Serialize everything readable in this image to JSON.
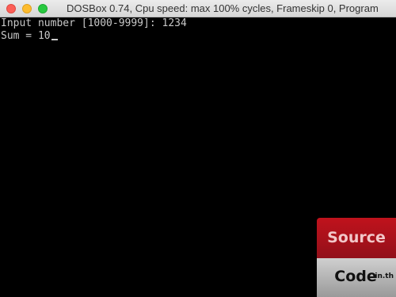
{
  "window": {
    "title": "DOSBox 0.74, Cpu speed: max 100% cycles, Frameskip  0, Program"
  },
  "console": {
    "lines": [
      "Input number [1000-9999]: 1234",
      "Sum = 10"
    ]
  },
  "watermark": {
    "top_label": "Source",
    "bottom_label": "Code",
    "domain": ".in.th"
  },
  "colors": {
    "background": "#000000",
    "text": "#c8c8c8",
    "badge_red": "#b01019",
    "badge_gray": "#b5b5b5"
  }
}
